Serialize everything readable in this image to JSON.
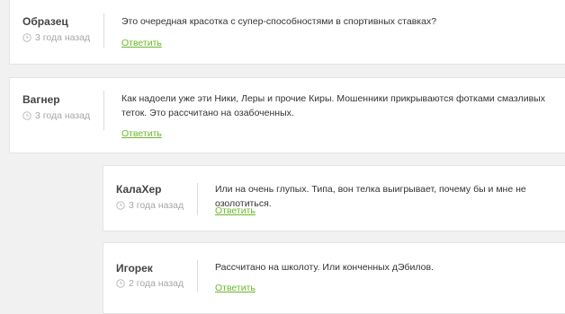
{
  "comments": [
    {
      "author": "Образец",
      "time": "3 года назад",
      "text": "Это очередная красотка с супер-способностями в спортивных ставках?",
      "reply_label": "Ответить"
    },
    {
      "author": "Вагнер",
      "time": "3 года назад",
      "text": "Как надоели уже эти Ники, Леры и прочие Киры. Мошенники прикрываются фотками смазливых теток. Это рассчитано на озабоченных.",
      "reply_label": "Ответить"
    },
    {
      "author": "КалаХер",
      "time": "3 года назад",
      "text": "Или на очень глупых. Типа, вон телка выигрывает, почему бы и мне не озолотиться.",
      "reply_label": "Ответить"
    },
    {
      "author": "Игорек",
      "time": "2 года назад",
      "text": "Рассчитано на школоту. Или конченных дЭбилов.",
      "reply_label": "Ответить"
    }
  ],
  "icons": {
    "time": "clock-icon"
  },
  "colors": {
    "reply_link": "#6ab82a",
    "meta_text": "#a6a6a6",
    "background": "#f1f1f1",
    "card": "#ffffff"
  }
}
